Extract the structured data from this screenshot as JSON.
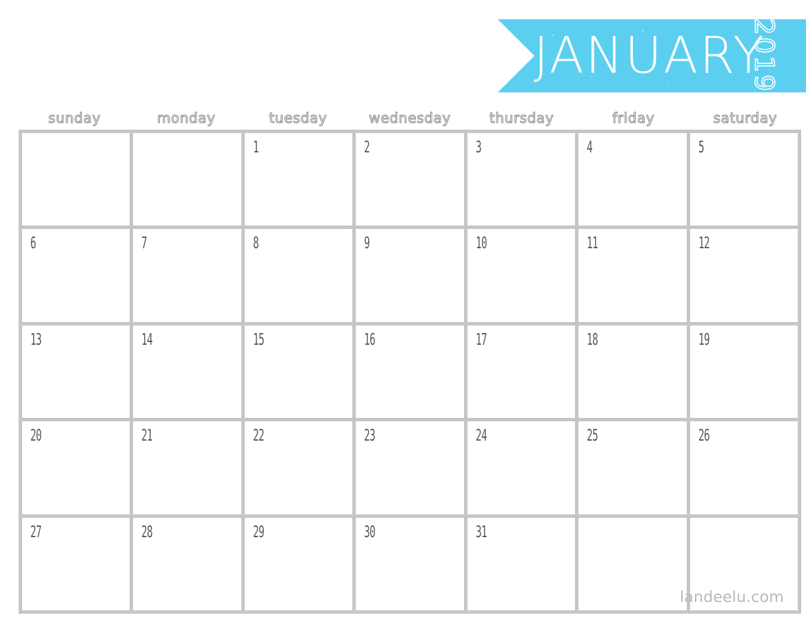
{
  "colors": {
    "accent": "#5CCFF0",
    "grid_line": "#c6c6c6",
    "cell_background": "#ffffff",
    "weekday_text": "#8b8b8b",
    "day_number_text": "#53565a",
    "watermark_text": "#b9b9b9",
    "page_background": "#ffffff"
  },
  "banner": {
    "month": "JANUARY",
    "year": "2019"
  },
  "weekdays": [
    {
      "label": "sunday"
    },
    {
      "label": "monday"
    },
    {
      "label": "tuesday"
    },
    {
      "label": "wednesday"
    },
    {
      "label": "thursday"
    },
    {
      "label": "friday"
    },
    {
      "label": "saturday"
    }
  ],
  "weeks": [
    [
      {
        "day": ""
      },
      {
        "day": ""
      },
      {
        "day": "1"
      },
      {
        "day": "2"
      },
      {
        "day": "3"
      },
      {
        "day": "4"
      },
      {
        "day": "5"
      }
    ],
    [
      {
        "day": "6"
      },
      {
        "day": "7"
      },
      {
        "day": "8"
      },
      {
        "day": "9"
      },
      {
        "day": "10"
      },
      {
        "day": "11"
      },
      {
        "day": "12"
      }
    ],
    [
      {
        "day": "13"
      },
      {
        "day": "14"
      },
      {
        "day": "15"
      },
      {
        "day": "16"
      },
      {
        "day": "17"
      },
      {
        "day": "18"
      },
      {
        "day": "19"
      }
    ],
    [
      {
        "day": "20"
      },
      {
        "day": "21"
      },
      {
        "day": "22"
      },
      {
        "day": "23"
      },
      {
        "day": "24"
      },
      {
        "day": "25"
      },
      {
        "day": "26"
      }
    ],
    [
      {
        "day": "27"
      },
      {
        "day": "28"
      },
      {
        "day": "29"
      },
      {
        "day": "30"
      },
      {
        "day": "31"
      },
      {
        "day": ""
      },
      {
        "day": ""
      }
    ]
  ],
  "watermark": {
    "text": "landeelu.com"
  }
}
